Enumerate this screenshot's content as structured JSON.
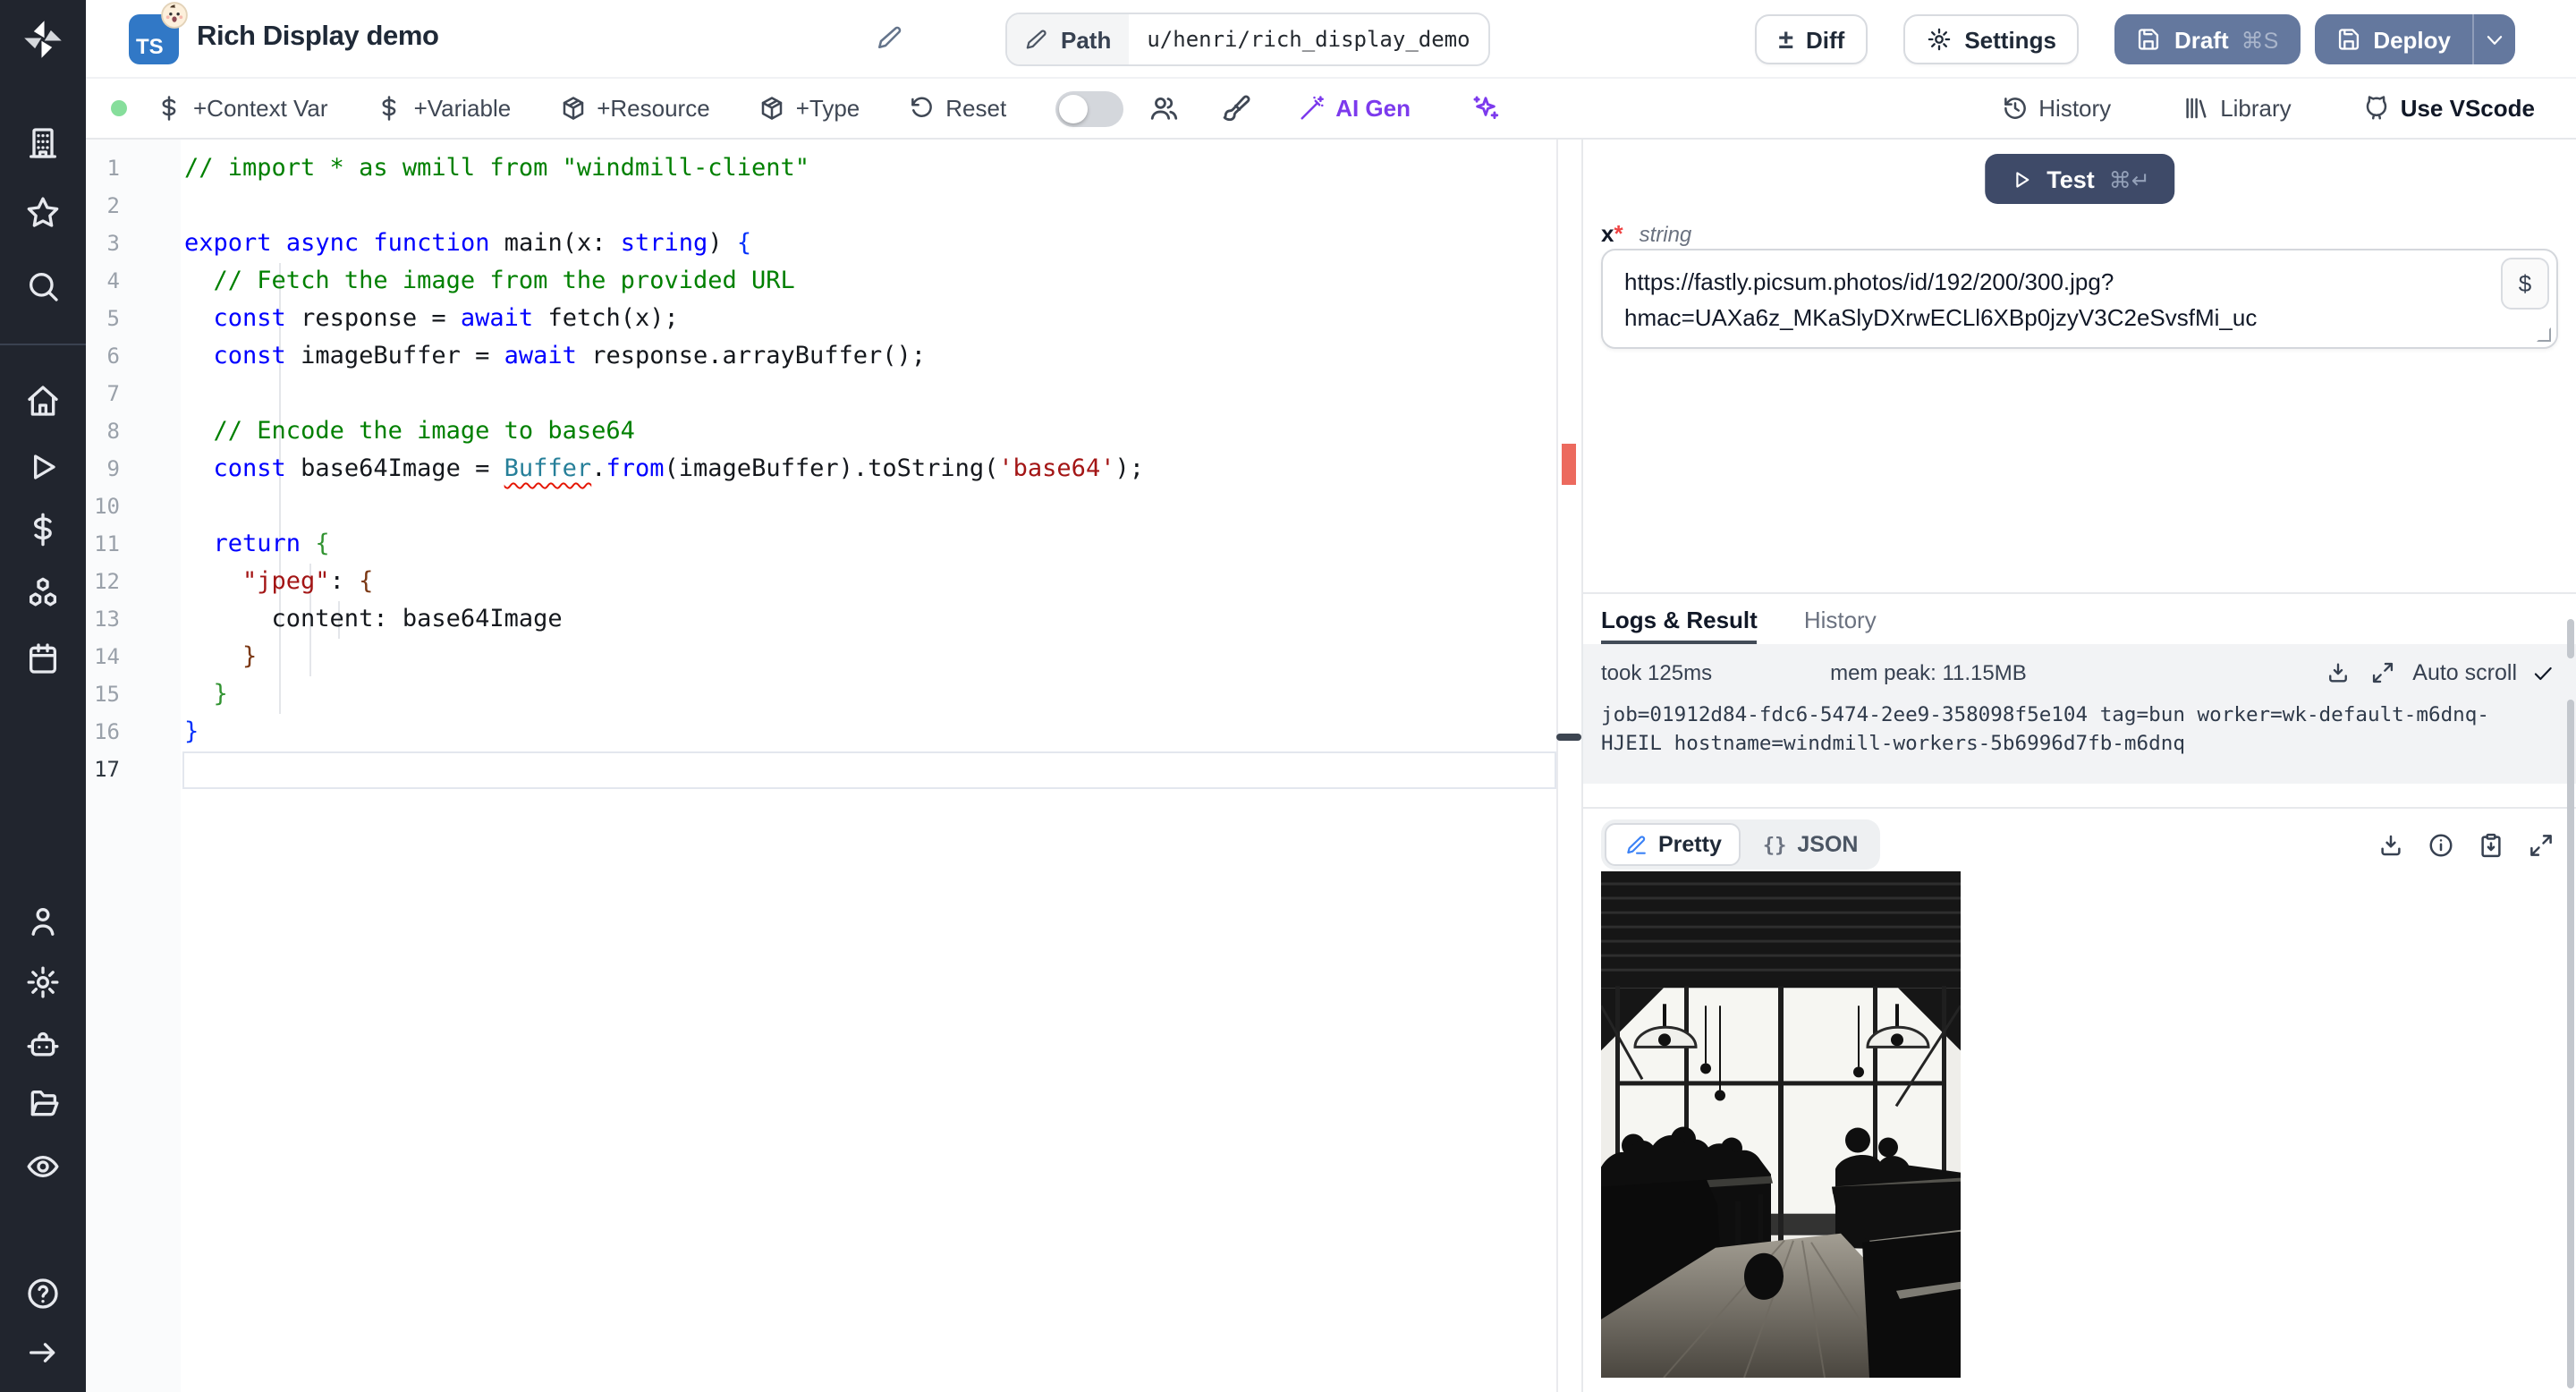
{
  "header": {
    "title": "Rich Display demo",
    "badge": "TS",
    "path_label": "Path",
    "path_value": "u/henri/rich_display_demo",
    "diff": "Diff",
    "settings": "Settings",
    "draft": "Draft",
    "draft_shortcut": "⌘S",
    "deploy": "Deploy",
    "diff_glyph": "±"
  },
  "toolbar": {
    "context_var": "+Context Var",
    "variable": "+Variable",
    "resource": "+Resource",
    "type": "+Type",
    "reset": "Reset",
    "ai_gen": "AI Gen",
    "history": "History",
    "library": "Library",
    "vscode": "Use VScode"
  },
  "editor": {
    "language": "typescript",
    "lines": [
      [
        [
          "c",
          "// import * as wmill from \"windmill-client\""
        ]
      ],
      [],
      [
        [
          "k",
          "export"
        ],
        [
          "d",
          " "
        ],
        [
          "k",
          "async"
        ],
        [
          "d",
          " "
        ],
        [
          "k",
          "function"
        ],
        [
          "d",
          " main(x: "
        ],
        [
          "k",
          "string"
        ],
        [
          "d",
          ") "
        ],
        [
          "b1",
          "{"
        ]
      ],
      [
        [
          "d",
          "  "
        ],
        [
          "c",
          "// Fetch the image from the provided URL"
        ]
      ],
      [
        [
          "d",
          "  "
        ],
        [
          "k",
          "const"
        ],
        [
          "d",
          " response = "
        ],
        [
          "k",
          "await"
        ],
        [
          "d",
          " fetch(x);"
        ]
      ],
      [
        [
          "d",
          "  "
        ],
        [
          "k",
          "const"
        ],
        [
          "d",
          " imageBuffer = "
        ],
        [
          "k",
          "await"
        ],
        [
          "d",
          " response.arrayBuffer();"
        ]
      ],
      [],
      [
        [
          "d",
          "  "
        ],
        [
          "c",
          "// Encode the image to base64"
        ]
      ],
      [
        [
          "d",
          "  "
        ],
        [
          "k",
          "const"
        ],
        [
          "d",
          " base64Image = "
        ],
        [
          "t",
          "Buffer"
        ],
        [
          "d",
          "."
        ],
        [
          "k",
          "from"
        ],
        [
          "d",
          "(imageBuffer).toString("
        ],
        [
          "s",
          "'base64'"
        ],
        [
          "d",
          ");"
        ]
      ],
      [],
      [
        [
          "d",
          "  "
        ],
        [
          "k",
          "return"
        ],
        [
          "d",
          " "
        ],
        [
          "b2",
          "{"
        ]
      ],
      [
        [
          "d",
          "    "
        ],
        [
          "s",
          "\"jpeg\""
        ],
        [
          "d",
          ": "
        ],
        [
          "b3",
          "{"
        ]
      ],
      [
        [
          "d",
          "      content: base64Image"
        ]
      ],
      [
        [
          "d",
          "    "
        ],
        [
          "b3",
          "}"
        ]
      ],
      [
        [
          "d",
          "  "
        ],
        [
          "b2",
          "}"
        ]
      ],
      [
        [
          "b1",
          "}"
        ]
      ],
      []
    ]
  },
  "runner": {
    "test": "Test",
    "test_shortcut": "⌘↵",
    "arg_name": "x",
    "arg_required_mark": "*",
    "arg_type": "string",
    "arg_value": "https://fastly.picsum.photos/id/192/200/300.jpg?hmac=UAXa6z_MKaSlyDXrwECLl6XBp0jzyV3C2eSvsfMi_uc",
    "arg_value_line1": "https://fastly.picsum.photos/id/192/200/300.jpg?",
    "arg_value_line2": "hmac=UAXa6z_MKaSlyDXrwECLl6XBp0jzyV3C2eSvsfMi_uc",
    "insert_var": "$"
  },
  "logs": {
    "tab_logs": "Logs & Result",
    "tab_history": "History",
    "took": "took 125ms",
    "mem": "mem peak: 11.15MB",
    "autoscroll": "Auto scroll",
    "line1": "job=01912d84-fdc6-5474-2ee9-358098f5e104 tag=bun worker=wk-default-m6dnq-",
    "line2": "HJEIL hostname=windmill-workers-5b6996d7fb-m6dnq"
  },
  "result": {
    "pretty": "Pretty",
    "json": "JSON",
    "json_glyph": "{}"
  },
  "colors": {
    "accent_button": "#64789e",
    "dark_button": "#3e4a68",
    "ai_purple": "#7c3aed",
    "error_mark": "#ec6a5e",
    "status_green": "#86de9b",
    "ts_badge_blue": "#3178c6",
    "sidebar_dark": "#21252e"
  }
}
